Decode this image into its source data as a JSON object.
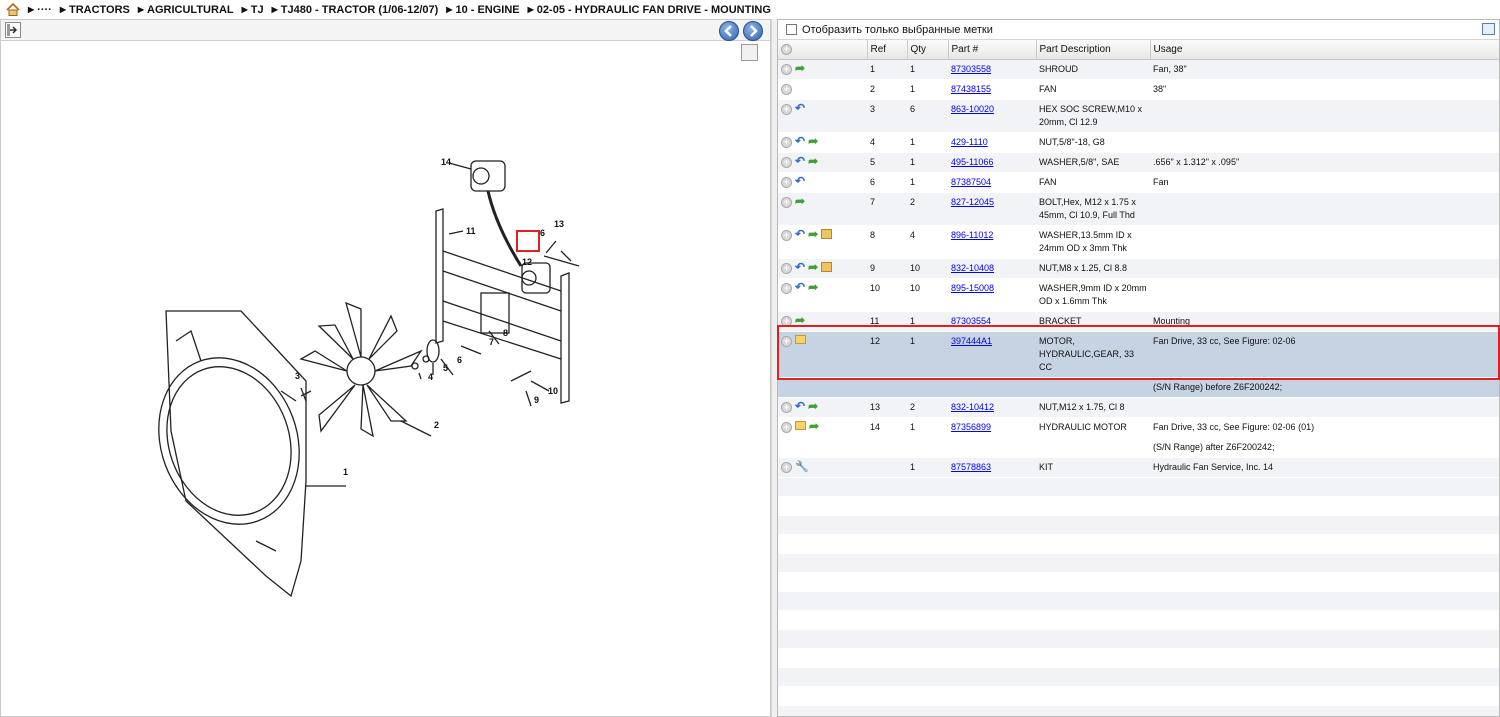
{
  "breadcrumb": {
    "items": [
      "····",
      "TRACTORS",
      "AGRICULTURAL",
      "TJ",
      "TJ480 - TRACTOR (1/06-12/07)",
      "10 - ENGINE",
      "02-05 - HYDRAULIC FAN DRIVE - MOUNTING"
    ]
  },
  "filter": {
    "label": "Отобразить только выбранные метки"
  },
  "table": {
    "headers": {
      "ref": "Ref",
      "qty": "Qty",
      "part": "Part #",
      "desc": "Part Description",
      "usage": "Usage"
    },
    "rows": [
      {
        "icons": [
          "arrow-right-icon"
        ],
        "ref": "1",
        "qty": "1",
        "part": "87303558",
        "desc": "SHROUD",
        "usage": "Fan, 38\""
      },
      {
        "icons": [],
        "ref": "2",
        "qty": "1",
        "part": "87438155",
        "desc": "FAN",
        "usage": "38\""
      },
      {
        "icons": [
          "arrow-left-icon"
        ],
        "ref": "3",
        "qty": "6",
        "part": "863-10020",
        "desc": "HEX SOC SCREW,M10 x 20mm, Cl 12.9",
        "usage": ""
      },
      {
        "icons": [
          "arrow-left-icon",
          "arrow-right-icon"
        ],
        "ref": "4",
        "qty": "1",
        "part": "429-1110",
        "desc": "NUT,5/8\"-18, G8",
        "usage": ""
      },
      {
        "icons": [
          "arrow-left-icon",
          "arrow-right-icon"
        ],
        "ref": "5",
        "qty": "1",
        "part": "495-11066",
        "desc": "WASHER,5/8\", SAE",
        "usage": ".656\" x 1.312\" x .095\""
      },
      {
        "icons": [
          "arrow-left-icon"
        ],
        "ref": "6",
        "qty": "1",
        "part": "87387504",
        "desc": "FAN",
        "usage": "Fan"
      },
      {
        "icons": [
          "arrow-right-icon"
        ],
        "ref": "7",
        "qty": "2",
        "part": "827-12045",
        "desc": "BOLT,Hex, M12 x 1.75 x 45mm, Cl 10.9, Full Thd",
        "usage": ""
      },
      {
        "icons": [
          "arrow-left-icon",
          "arrow-right-icon",
          "box-icon"
        ],
        "ref": "8",
        "qty": "4",
        "part": "896-11012",
        "desc": "WASHER,13.5mm ID x 24mm OD x 3mm Thk",
        "usage": ""
      },
      {
        "icons": [
          "arrow-left-icon",
          "arrow-right-icon",
          "box-icon"
        ],
        "ref": "9",
        "qty": "10",
        "part": "832-10408",
        "desc": "NUT,M8 x 1.25, Cl 8.8",
        "usage": ""
      },
      {
        "icons": [
          "arrow-left-icon",
          "arrow-right-icon"
        ],
        "ref": "10",
        "qty": "10",
        "part": "895-15008",
        "desc": "WASHER,9mm ID x 20mm OD x 1.6mm Thk",
        "usage": ""
      },
      {
        "icons": [
          "arrow-right-icon"
        ],
        "ref": "11",
        "qty": "1",
        "part": "87303554",
        "desc": "BRACKET",
        "usage": "Mounting"
      },
      {
        "icons": [
          "folder-icon"
        ],
        "ref": "12",
        "qty": "1",
        "part": "397444A1",
        "desc": "MOTOR, HYDRAULIC,GEAR, 33 CC",
        "usage": "Fan Drive, 33 cc, See Figure: 02-06",
        "usage2": "(S/N Range) before Z6F200242;",
        "selected": true
      },
      {
        "icons": [
          "arrow-left-icon",
          "arrow-right-icon"
        ],
        "ref": "13",
        "qty": "2",
        "part": "832-10412",
        "desc": "NUT,M12 x 1.75, Cl 8",
        "usage": ""
      },
      {
        "icons": [
          "folder-icon",
          "arrow-right-icon"
        ],
        "ref": "14",
        "qty": "1",
        "part": "87356899",
        "desc": "HYDRAULIC MOTOR",
        "usage": "Fan Drive, 33 cc, See Figure: 02-06 (01)",
        "usage2": "(S/N Range) after Z6F200242;"
      },
      {
        "icons": [
          "wrench-icon"
        ],
        "ref": "",
        "qty": "1",
        "part": "87578863",
        "desc": "KIT",
        "usage": "Hydraulic Fan Service, Inc. 14"
      }
    ]
  },
  "diagram": {
    "callouts": [
      "1",
      "2",
      "3",
      "4",
      "5",
      "6",
      "7",
      "8",
      "9",
      "10",
      "11",
      "12",
      "13",
      "14",
      "6"
    ],
    "highlighted_callout": "12"
  },
  "colors": {
    "selected_row": "#c5d3e3",
    "highlight_border": "#e02020",
    "link": "#0000ee"
  }
}
